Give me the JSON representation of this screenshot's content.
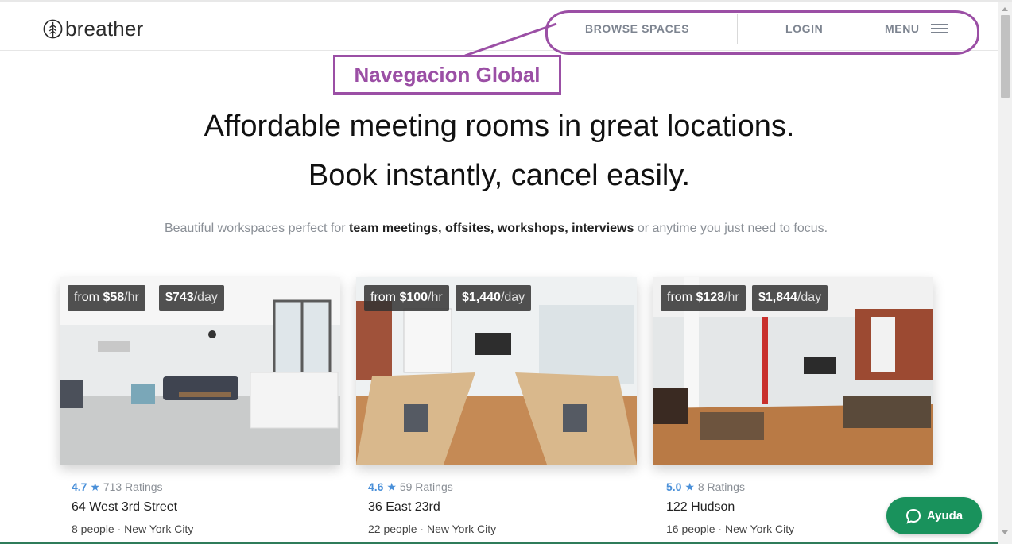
{
  "header": {
    "logo_text": "breather",
    "logo_icon": "tree-leaf-icon",
    "nav": {
      "browse_label": "BROWSE SPACES",
      "login_label": "LOGIN",
      "menu_label": "MENU",
      "menu_icon": "hamburger-icon"
    }
  },
  "annotation": {
    "label": "Navegacion Global",
    "color": "#9b4fa5"
  },
  "hero": {
    "line1": "Affordable meeting rooms in great locations.",
    "line2": "Book instantly, cancel easily."
  },
  "subtitle": {
    "before": "Beautiful workspaces perfect for ",
    "highlight": "team meetings, offsites, workshops, interviews",
    "after": " or anytime you just need to focus."
  },
  "listings": [
    {
      "hourly_prefix": "from ",
      "hourly": "$58",
      "hourly_unit": "/hr",
      "daily": "$743",
      "daily_unit": "/day",
      "rating": "4.7",
      "star": "★",
      "ratings_count": "713 Ratings",
      "address": "64 West 3rd Street",
      "capacity": "8 people",
      "separator": " · ",
      "city": "New York City"
    },
    {
      "hourly_prefix": "from ",
      "hourly": "$100",
      "hourly_unit": "/hr",
      "daily": "$1,440",
      "daily_unit": "/day",
      "rating": "4.6",
      "star": "★",
      "ratings_count": "59 Ratings",
      "address": "36 East 23rd",
      "capacity": "22 people",
      "separator": " · ",
      "city": "New York City"
    },
    {
      "hourly_prefix": "from ",
      "hourly": "$128",
      "hourly_unit": "/hr",
      "daily": "$1,844",
      "daily_unit": "/day",
      "rating": "5.0",
      "star": "★",
      "ratings_count": "8 Ratings",
      "address": "122 Hudson",
      "capacity": "16 people",
      "separator": " · ",
      "city": "New York City"
    }
  ],
  "help": {
    "label": "Ayuda",
    "icon": "chat-bubble-icon",
    "color": "#19925c"
  },
  "colors": {
    "accent_blue": "#4a90d9",
    "nav_gray": "#7d8490"
  }
}
